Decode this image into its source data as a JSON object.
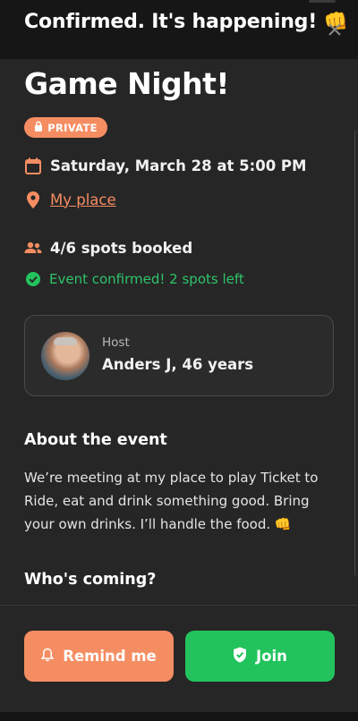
{
  "banner": {
    "title": "Confirmed. It's happening! 👊"
  },
  "event": {
    "title": "Game Night!",
    "badge": "PRIVATE",
    "date": "Saturday, March 28 at 5:00 PM",
    "place": "My place",
    "spots": "4/6 spots booked",
    "status": "Event confirmed! 2 spots left"
  },
  "host": {
    "label": "Host",
    "name": "Anders J, 46 years"
  },
  "about": {
    "heading": "About the event",
    "text": "We’re meeting at my place to play Ticket to Ride, eat and drink something good. Bring your own drinks. I’ll handle the food. 👊"
  },
  "coming": {
    "heading": "Who's coming?"
  },
  "actions": {
    "remind_label": "Remind me",
    "join_label": "Join"
  },
  "colors": {
    "accent": "#f58d62",
    "success": "#22c35d",
    "background": "#262626"
  },
  "icons": [
    "close-icon",
    "lock-icon",
    "calendar-icon",
    "location-pin-icon",
    "people-icon",
    "check-circle-icon",
    "bell-icon",
    "shield-check-icon"
  ]
}
